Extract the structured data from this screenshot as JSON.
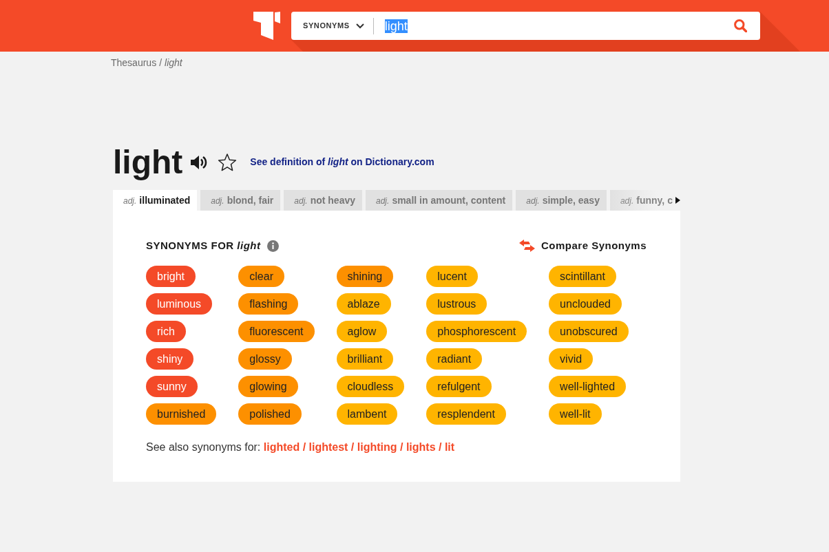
{
  "header": {
    "search": {
      "category": "SYNONYMS",
      "value": "light",
      "value_selected": true
    }
  },
  "breadcrumb": {
    "items": [
      "Thesaurus",
      "light"
    ],
    "separator": "/"
  },
  "entry": {
    "word": "light",
    "definition_link": "See definition of *light* on Dictionary.com"
  },
  "tabs": [
    {
      "pos": "adj.",
      "label": "illuminated",
      "selected": true,
      "faded": false
    },
    {
      "pos": "adj.",
      "label": "blond, fair",
      "selected": false,
      "faded": false
    },
    {
      "pos": "adj.",
      "label": "not heavy",
      "selected": false,
      "faded": false
    },
    {
      "pos": "adj.",
      "label": "small in amount, content",
      "selected": false,
      "faded": false
    },
    {
      "pos": "adj.",
      "label": "simple, easy",
      "selected": false,
      "faded": false
    },
    {
      "pos": "adj.",
      "label": "funny, c",
      "selected": false,
      "faded": true
    }
  ],
  "synonyms": {
    "heading": "SYNONYMS FOR *light*",
    "compare_label": "Compare Synonyms",
    "columns": [
      [
        {
          "word": "bright",
          "color": "#f44a28"
        },
        {
          "word": "luminous",
          "color": "#f44a28"
        },
        {
          "word": "rich",
          "color": "#f44a28"
        },
        {
          "word": "shiny",
          "color": "#f44a28"
        },
        {
          "word": "sunny",
          "color": "#f44a28"
        },
        {
          "word": "burnished",
          "color": "#fd9000"
        }
      ],
      [
        {
          "word": "clear",
          "color": "#fd9000"
        },
        {
          "word": "flashing",
          "color": "#fd9000"
        },
        {
          "word": "fluorescent",
          "color": "#fd9000"
        },
        {
          "word": "glossy",
          "color": "#fd9000"
        },
        {
          "word": "glowing",
          "color": "#fd9000"
        },
        {
          "word": "polished",
          "color": "#fd9000"
        }
      ],
      [
        {
          "word": "shining",
          "color": "#fd9000"
        },
        {
          "word": "ablaze",
          "color": "#ffb400"
        },
        {
          "word": "aglow",
          "color": "#ffb400"
        },
        {
          "word": "brilliant",
          "color": "#ffb400"
        },
        {
          "word": "cloudless",
          "color": "#ffb400"
        },
        {
          "word": "lambent",
          "color": "#ffb400"
        }
      ],
      [
        {
          "word": "lucent",
          "color": "#ffb400"
        },
        {
          "word": "lustrous",
          "color": "#ffb400"
        },
        {
          "word": "phosphorescent",
          "color": "#ffb400"
        },
        {
          "word": "radiant",
          "color": "#ffb400"
        },
        {
          "word": "refulgent",
          "color": "#ffb400"
        },
        {
          "word": "resplendent",
          "color": "#ffb400"
        }
      ],
      [
        {
          "word": "scintillant",
          "color": "#ffb400"
        },
        {
          "word": "unclouded",
          "color": "#ffb400"
        },
        {
          "word": "unobscured",
          "color": "#ffb400"
        },
        {
          "word": "vivid",
          "color": "#ffb400"
        },
        {
          "word": "well-lighted",
          "color": "#ffb400"
        },
        {
          "word": "well-lit",
          "color": "#ffb400"
        }
      ]
    ],
    "see_also": {
      "label": "See also synonyms for:",
      "links": [
        "lighted",
        "lightest",
        "lighting",
        "lights",
        "lit"
      ],
      "separator": "/"
    }
  }
}
